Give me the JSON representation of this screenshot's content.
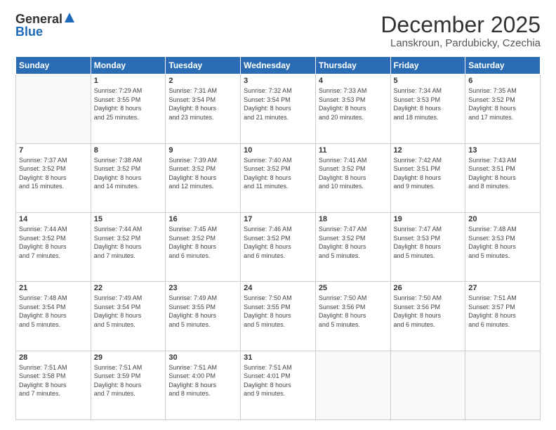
{
  "logo": {
    "general": "General",
    "blue": "Blue"
  },
  "header": {
    "title": "December 2025",
    "subtitle": "Lanskroun, Pardubicky, Czechia"
  },
  "weekdays": [
    "Sunday",
    "Monday",
    "Tuesday",
    "Wednesday",
    "Thursday",
    "Friday",
    "Saturday"
  ],
  "weeks": [
    [
      {
        "day": "",
        "info": ""
      },
      {
        "day": "1",
        "info": "Sunrise: 7:29 AM\nSunset: 3:55 PM\nDaylight: 8 hours\nand 25 minutes."
      },
      {
        "day": "2",
        "info": "Sunrise: 7:31 AM\nSunset: 3:54 PM\nDaylight: 8 hours\nand 23 minutes."
      },
      {
        "day": "3",
        "info": "Sunrise: 7:32 AM\nSunset: 3:54 PM\nDaylight: 8 hours\nand 21 minutes."
      },
      {
        "day": "4",
        "info": "Sunrise: 7:33 AM\nSunset: 3:53 PM\nDaylight: 8 hours\nand 20 minutes."
      },
      {
        "day": "5",
        "info": "Sunrise: 7:34 AM\nSunset: 3:53 PM\nDaylight: 8 hours\nand 18 minutes."
      },
      {
        "day": "6",
        "info": "Sunrise: 7:35 AM\nSunset: 3:52 PM\nDaylight: 8 hours\nand 17 minutes."
      }
    ],
    [
      {
        "day": "7",
        "info": "Sunrise: 7:37 AM\nSunset: 3:52 PM\nDaylight: 8 hours\nand 15 minutes."
      },
      {
        "day": "8",
        "info": "Sunrise: 7:38 AM\nSunset: 3:52 PM\nDaylight: 8 hours\nand 14 minutes."
      },
      {
        "day": "9",
        "info": "Sunrise: 7:39 AM\nSunset: 3:52 PM\nDaylight: 8 hours\nand 12 minutes."
      },
      {
        "day": "10",
        "info": "Sunrise: 7:40 AM\nSunset: 3:52 PM\nDaylight: 8 hours\nand 11 minutes."
      },
      {
        "day": "11",
        "info": "Sunrise: 7:41 AM\nSunset: 3:52 PM\nDaylight: 8 hours\nand 10 minutes."
      },
      {
        "day": "12",
        "info": "Sunrise: 7:42 AM\nSunset: 3:51 PM\nDaylight: 8 hours\nand 9 minutes."
      },
      {
        "day": "13",
        "info": "Sunrise: 7:43 AM\nSunset: 3:51 PM\nDaylight: 8 hours\nand 8 minutes."
      }
    ],
    [
      {
        "day": "14",
        "info": "Sunrise: 7:44 AM\nSunset: 3:52 PM\nDaylight: 8 hours\nand 7 minutes."
      },
      {
        "day": "15",
        "info": "Sunrise: 7:44 AM\nSunset: 3:52 PM\nDaylight: 8 hours\nand 7 minutes."
      },
      {
        "day": "16",
        "info": "Sunrise: 7:45 AM\nSunset: 3:52 PM\nDaylight: 8 hours\nand 6 minutes."
      },
      {
        "day": "17",
        "info": "Sunrise: 7:46 AM\nSunset: 3:52 PM\nDaylight: 8 hours\nand 6 minutes."
      },
      {
        "day": "18",
        "info": "Sunrise: 7:47 AM\nSunset: 3:52 PM\nDaylight: 8 hours\nand 5 minutes."
      },
      {
        "day": "19",
        "info": "Sunrise: 7:47 AM\nSunset: 3:53 PM\nDaylight: 8 hours\nand 5 minutes."
      },
      {
        "day": "20",
        "info": "Sunrise: 7:48 AM\nSunset: 3:53 PM\nDaylight: 8 hours\nand 5 minutes."
      }
    ],
    [
      {
        "day": "21",
        "info": "Sunrise: 7:48 AM\nSunset: 3:54 PM\nDaylight: 8 hours\nand 5 minutes."
      },
      {
        "day": "22",
        "info": "Sunrise: 7:49 AM\nSunset: 3:54 PM\nDaylight: 8 hours\nand 5 minutes."
      },
      {
        "day": "23",
        "info": "Sunrise: 7:49 AM\nSunset: 3:55 PM\nDaylight: 8 hours\nand 5 minutes."
      },
      {
        "day": "24",
        "info": "Sunrise: 7:50 AM\nSunset: 3:55 PM\nDaylight: 8 hours\nand 5 minutes."
      },
      {
        "day": "25",
        "info": "Sunrise: 7:50 AM\nSunset: 3:56 PM\nDaylight: 8 hours\nand 5 minutes."
      },
      {
        "day": "26",
        "info": "Sunrise: 7:50 AM\nSunset: 3:56 PM\nDaylight: 8 hours\nand 6 minutes."
      },
      {
        "day": "27",
        "info": "Sunrise: 7:51 AM\nSunset: 3:57 PM\nDaylight: 8 hours\nand 6 minutes."
      }
    ],
    [
      {
        "day": "28",
        "info": "Sunrise: 7:51 AM\nSunset: 3:58 PM\nDaylight: 8 hours\nand 7 minutes."
      },
      {
        "day": "29",
        "info": "Sunrise: 7:51 AM\nSunset: 3:59 PM\nDaylight: 8 hours\nand 7 minutes."
      },
      {
        "day": "30",
        "info": "Sunrise: 7:51 AM\nSunset: 4:00 PM\nDaylight: 8 hours\nand 8 minutes."
      },
      {
        "day": "31",
        "info": "Sunrise: 7:51 AM\nSunset: 4:01 PM\nDaylight: 8 hours\nand 9 minutes."
      },
      {
        "day": "",
        "info": ""
      },
      {
        "day": "",
        "info": ""
      },
      {
        "day": "",
        "info": ""
      }
    ]
  ]
}
